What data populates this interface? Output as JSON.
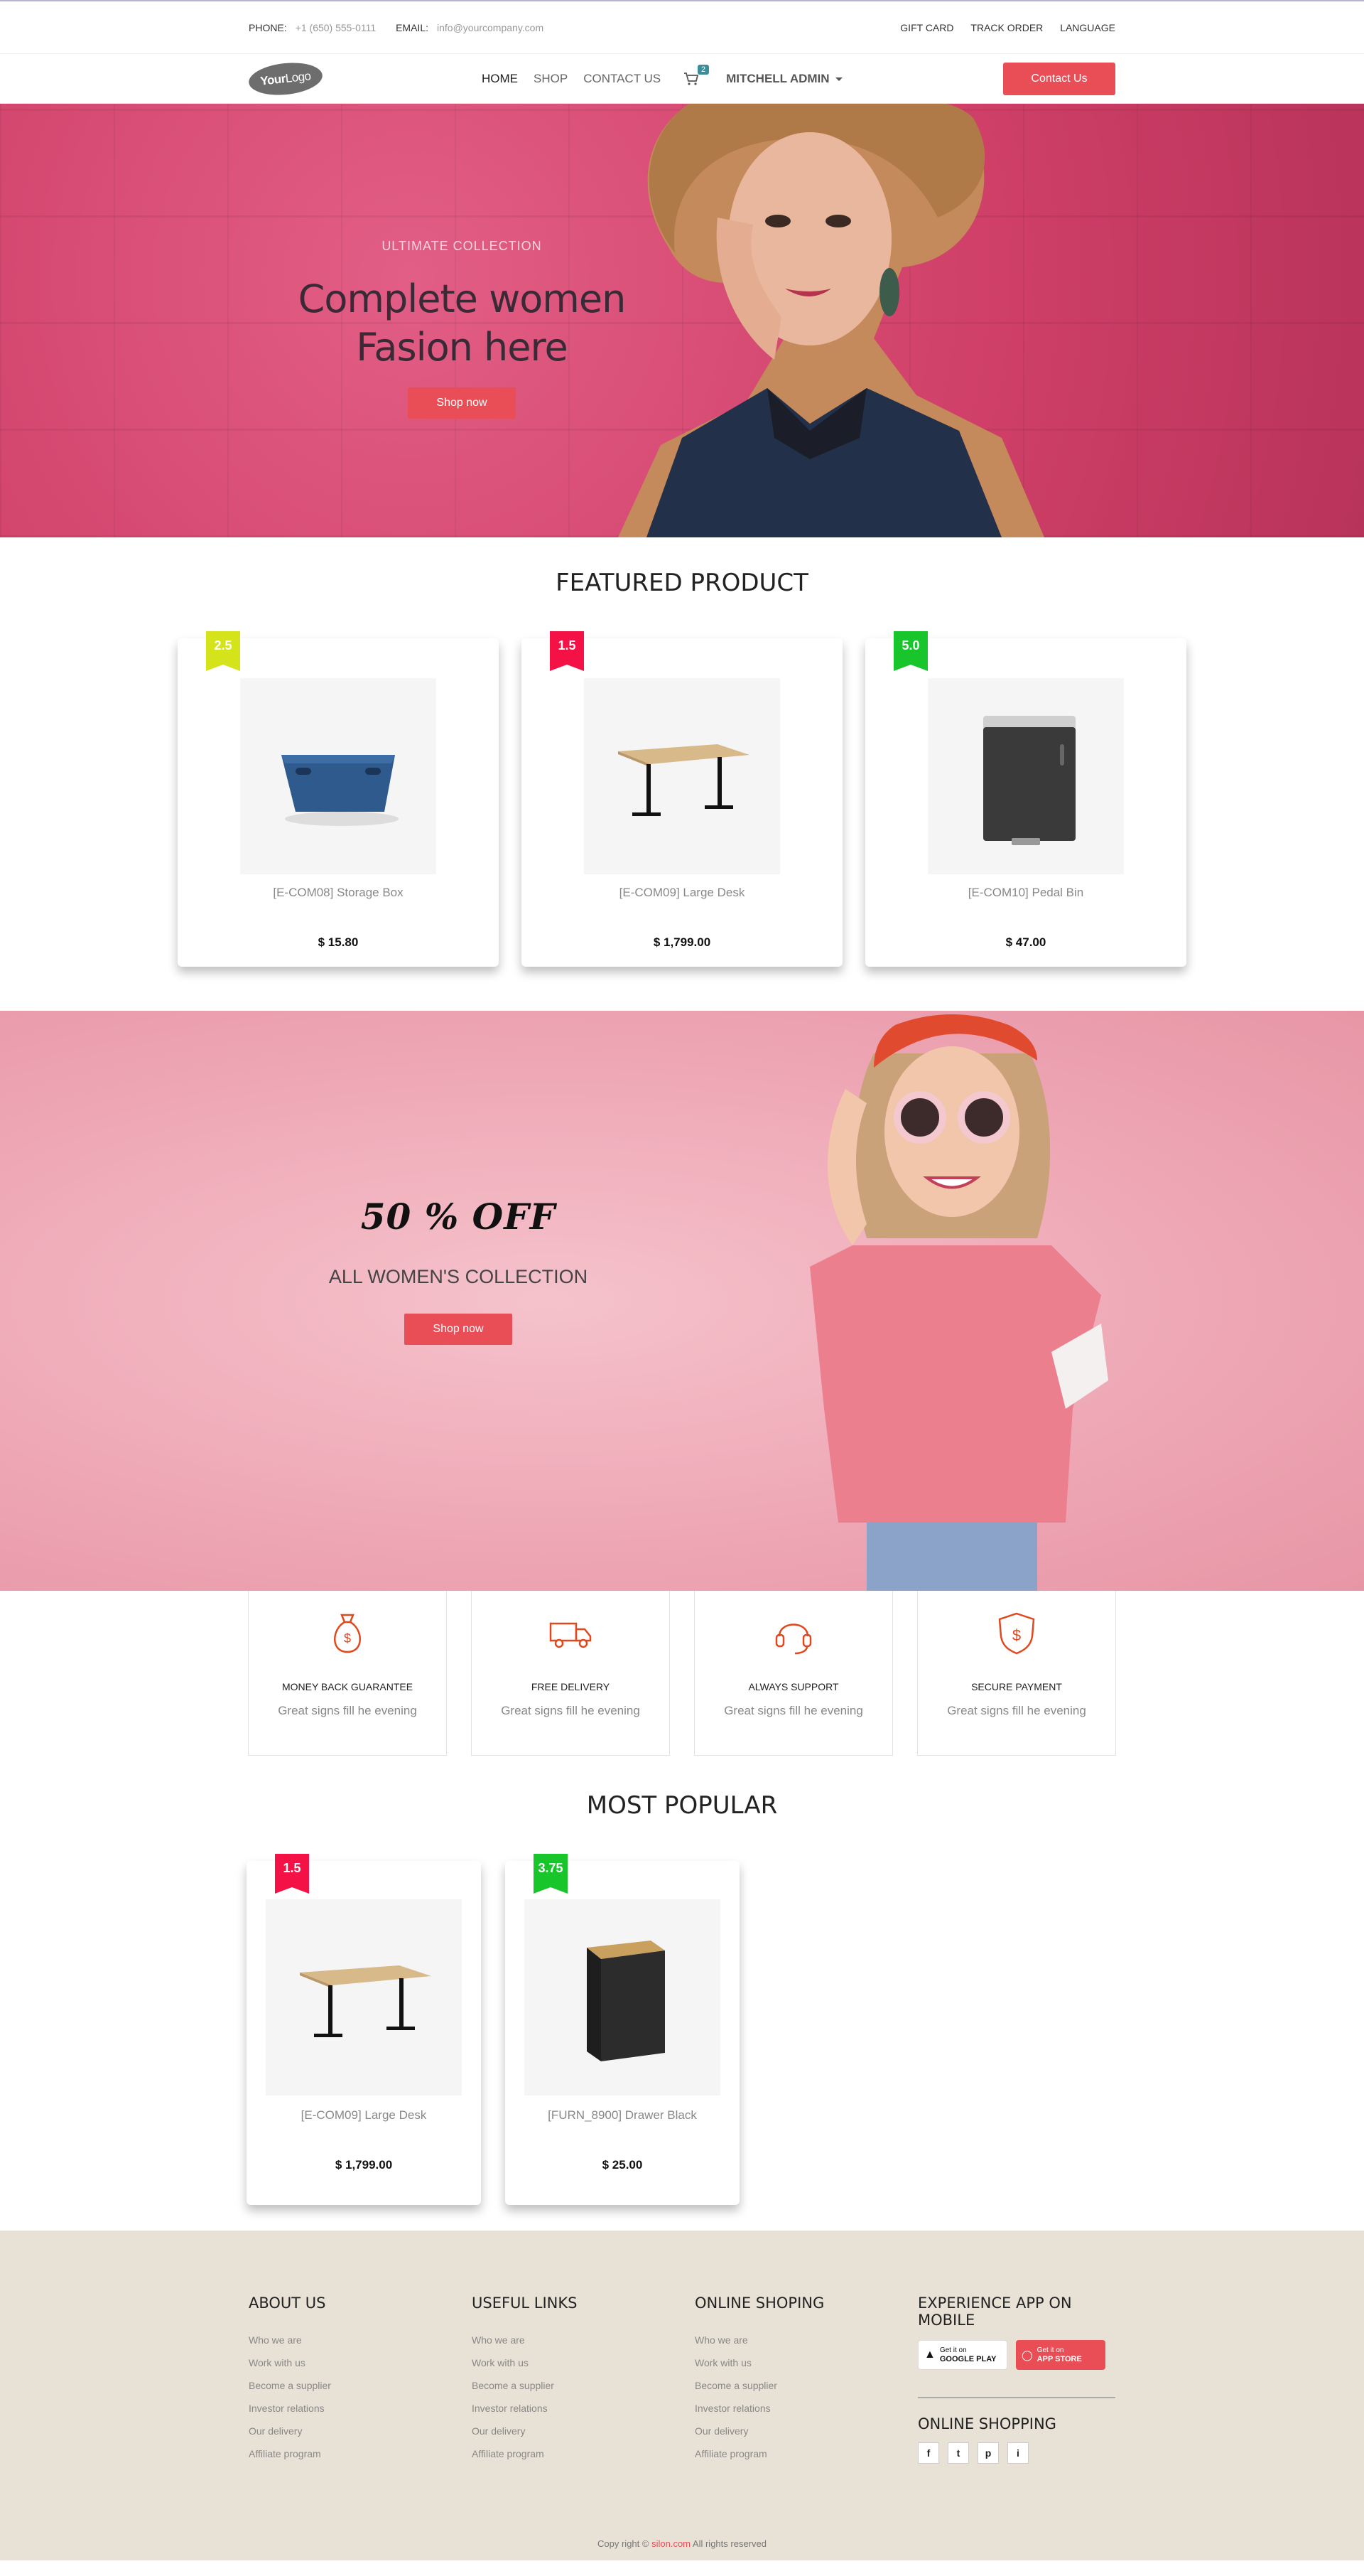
{
  "topbar": {
    "phone_label": "PHONE:",
    "phone": "+1 (650) 555-0111",
    "email_label": "EMAIL:",
    "email": "info@yourcompany.com",
    "links": [
      "GIFT CARD",
      "TRACK ORDER",
      "LANGUAGE"
    ]
  },
  "navbar": {
    "logo_bold": "Your",
    "logo_light": "Logo",
    "links": [
      {
        "label": "HOME",
        "active": true
      },
      {
        "label": "SHOP",
        "active": false
      },
      {
        "label": "CONTACT US",
        "active": false
      }
    ],
    "cart_count": "2",
    "user": "MITCHELL ADMIN",
    "contact_button": "Contact Us"
  },
  "hero": {
    "subtitle": "ULTIMATE COLLECTION",
    "title_line1": "Complete women",
    "title_line2": "Fasion here",
    "button": "Shop now"
  },
  "featured": {
    "title": "FEATURED PRODUCT",
    "products": [
      {
        "rating": "2.5",
        "rating_color": "#d4e31a",
        "name": "[E-COM08] Storage Box",
        "price": "$ 15.80",
        "image": "storage-box"
      },
      {
        "rating": "1.5",
        "rating_color": "#f31146",
        "name": "[E-COM09] Large Desk",
        "price": "$ 1,799.00",
        "image": "desk"
      },
      {
        "rating": "5.0",
        "rating_color": "#18c52a",
        "name": "[E-COM10] Pedal Bin",
        "price": "$ 47.00",
        "image": "pedal-bin"
      }
    ]
  },
  "promo": {
    "headline": "50 % OFF",
    "subtitle": "ALL WOMEN'S COLLECTION",
    "button": "Shop now"
  },
  "features": [
    {
      "icon": "money-bag-icon",
      "title": "MONEY BACK GUARANTEE",
      "desc": "Great signs fill he evening"
    },
    {
      "icon": "truck-icon",
      "title": "FREE DELIVERY",
      "desc": "Great signs fill he evening"
    },
    {
      "icon": "headset-icon",
      "title": "ALWAYS SUPPORT",
      "desc": "Great signs fill he evening"
    },
    {
      "icon": "shield-dollar-icon",
      "title": "SECURE PAYMENT",
      "desc": "Great signs fill he evening"
    }
  ],
  "popular": {
    "title": "MOST POPULAR",
    "products": [
      {
        "rating": "1.5",
        "rating_color": "#f31146",
        "name": "[E-COM09] Large Desk",
        "price": "$ 1,799.00",
        "image": "desk"
      },
      {
        "rating": "3.75",
        "rating_color": "#18c52a",
        "name": "[FURN_8900] Drawer Black",
        "price": "$ 25.00",
        "image": "drawer"
      }
    ]
  },
  "footer": {
    "columns": [
      {
        "title": "ABOUT US",
        "links": [
          "Who we are",
          "Work with us",
          "Become a supplier",
          "Investor relations",
          "Our delivery",
          "Affiliate program"
        ]
      },
      {
        "title": "USEFUL LINKS",
        "links": [
          "Who we are",
          "Work with us",
          "Become a supplier",
          "Investor relations",
          "Our delivery",
          "Affiliate program"
        ]
      },
      {
        "title": "ONLINE SHOPING",
        "links": [
          "Who we are",
          "Work with us",
          "Become a supplier",
          "Investor relations",
          "Our delivery",
          "Affiliate program"
        ]
      }
    ],
    "app": {
      "title": "EXPERIENCE APP ON MOBILE",
      "google_small": "Get it on",
      "google_big": "GOOGLE PLAY",
      "apple_small": "Get it on",
      "apple_big": "APP STORE"
    },
    "social_title": "ONLINE SHOPPING",
    "social_icons": [
      "f",
      "t",
      "p",
      "i"
    ],
    "copyright_prefix": "Copy right ©",
    "copyright_brand": "silon.com",
    "copyright_suffix": "All rights reserved"
  },
  "colors": {
    "accent": "#e94e57",
    "hero_bg": "#d6466f",
    "promo_bg": "#eea6b4",
    "footer_bg": "#e8e1d6",
    "feature_icon": "#e2481e"
  }
}
